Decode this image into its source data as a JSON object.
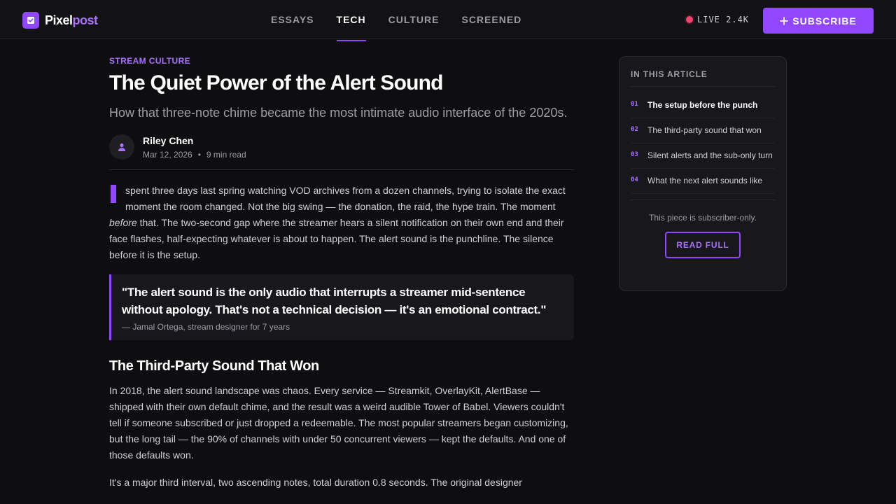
{
  "brand": {
    "name_part1": "Pixel",
    "name_part2": "post",
    "logo_icon": "check-square-icon",
    "accent": "#9147ff"
  },
  "nav": {
    "tabs": [
      {
        "label": "ESSAYS",
        "active": false
      },
      {
        "label": "TECH",
        "active": true
      },
      {
        "label": "CULTURE",
        "active": false
      },
      {
        "label": "SCREENED",
        "active": false
      }
    ]
  },
  "live": {
    "label": "LIVE 2.4K",
    "dot_color": "#eb4669"
  },
  "subscribe": {
    "label": "SUBSCRIBE",
    "icon": "plus-icon"
  },
  "article": {
    "kicker": "STREAM CULTURE",
    "title": "The Quiet Power of the Alert Sound",
    "dek": "How that three-note chime became the most intimate audio interface of the 2020s.",
    "author": {
      "name": "Riley Chen",
      "date": "Mar 12, 2026",
      "read_time": "9 min read",
      "separator": "•",
      "avatar_icon": "user-icon"
    },
    "intro": {
      "first_word": "I",
      "text_a": "spent three days last spring watching VOD archives from a dozen channels, trying to isolate the exact moment the room changed. Not the big swing — the donation, the raid, the hype train. The moment ",
      "emphasis": "before",
      "text_b": " that. The two-second gap where the streamer hears a silent notification on their own end and their face flashes, half-expecting whatever is about to happen. The alert sound is the punchline. The silence before it is the setup."
    },
    "pullquote": {
      "text": "\"The alert sound is the only audio that interrupts a streamer mid-sentence without apology. That's not a technical decision — it's an emotional contract.\"",
      "cite": "— Jamal Ortega, stream designer for 7 years"
    },
    "section_heading": "The Third-Party Sound That Won",
    "para2": "In 2018, the alert sound landscape was chaos. Every service — Streamkit, OverlayKit, AlertBase — shipped with their own default chime, and the result was a weird audible Tower of Babel. Viewers couldn't tell if someone subscribed or just dropped a redeemable. The most popular streamers began customizing, but the long tail — the 90% of channels with under 50 concurrent viewers — kept the defaults. And one of those defaults won.",
    "para3": "It's a major third interval, two ascending notes, total duration 0.8 seconds. The original designer"
  },
  "toc": {
    "heading": "IN THIS ARTICLE",
    "items": [
      {
        "num": "01",
        "label": "The setup before the punch",
        "current": true
      },
      {
        "num": "02",
        "label": "The third-party sound that won",
        "current": false
      },
      {
        "num": "03",
        "label": "Silent alerts and the sub-only turn",
        "current": false
      },
      {
        "num": "04",
        "label": "What the next alert sounds like",
        "current": false
      }
    ],
    "note": "This piece is subscriber-only.",
    "button": "READ FULL"
  }
}
